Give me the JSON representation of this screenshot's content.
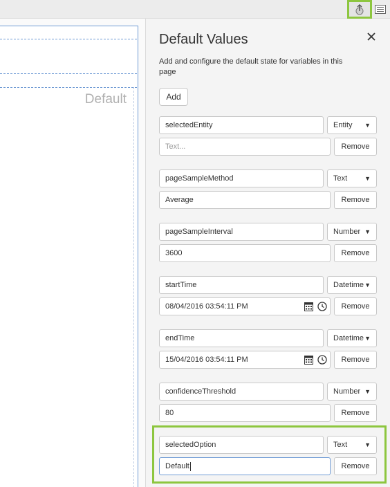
{
  "canvas": {
    "default_label": "Default"
  },
  "panel": {
    "title": "Default Values",
    "description": "Add and configure the default state for variables in this page",
    "add_label": "Add",
    "remove_label": "Remove",
    "variables": [
      {
        "name": "selectedEntity",
        "type": "Entity",
        "value": "",
        "placeholder": "Text..."
      },
      {
        "name": "pageSampleMethod",
        "type": "Text",
        "value": "Average"
      },
      {
        "name": "pageSampleInterval",
        "type": "Number",
        "value": "3600"
      },
      {
        "name": "startTime",
        "type": "Datetime",
        "value": "08/04/2016 03:54:11 PM"
      },
      {
        "name": "endTime",
        "type": "Datetime",
        "value": "15/04/2016 03:54:11 PM"
      },
      {
        "name": "confidenceThreshold",
        "type": "Number",
        "value": "80"
      },
      {
        "name": "selectedOption",
        "type": "Text",
        "value": "Default"
      }
    ]
  },
  "icons": {
    "upload": "upload-icon",
    "list": "list-icon",
    "close": "close-icon",
    "calendar": "calendar-icon",
    "clock": "clock-icon",
    "caret": "caret-down-icon"
  },
  "colors": {
    "highlight": "#8dc63f",
    "frame": "#6e9ad4"
  }
}
